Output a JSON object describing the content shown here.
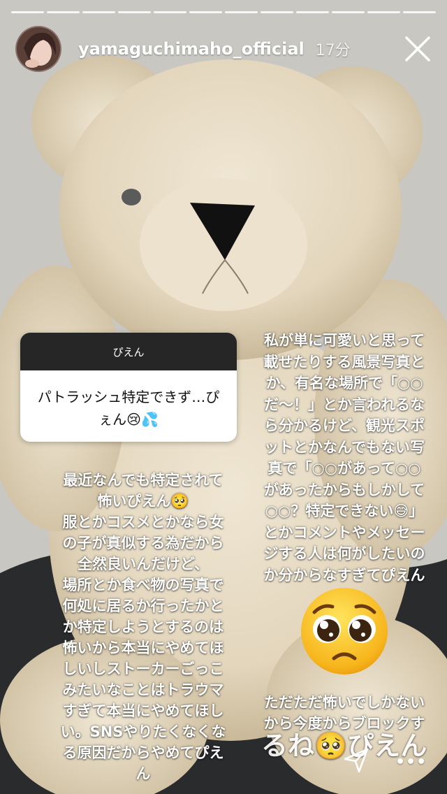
{
  "story": {
    "segments": 12,
    "username": "yamaguchimaho_official",
    "time": "17分"
  },
  "question_sticker": {
    "header": "ぴえん",
    "body": "パトラッシュ特定できず…ぴぇん😢💦"
  },
  "left_text": "最近なんでも特定されて\n怖いぴえん🥺\n服とかコスメとかなら女\nの子が真似する為だから\n全然良いんだけど、\n場所とか食べ物の写真で\n何処に居るか行ったかと\nか特定しようとするのは\n怖いから本当にやめてほ\nしいしストーカーごっこ\nみたいなことはトラウマ\nすぎて本当にやめてほし\nい。SNSやりたくなくな\nる原因だからやめてぴえ\nん",
  "right_text": "私が単に可愛いと思って\n載せたりする風景写真と\nか、有名な場所で「○○\nだ〜！」とか言われるな\nら分かるけど、観光スポ\nットとかなんでもない写\n真で「○○があって○○\nがあったからもしかして\n○○？特定できない😅」\nとかコメントやメッセー\nジする人は何がしたいの\nか分からなすぎてぴえん",
  "bottom_text_1": "ただただ怖いでしかない\nから今度からブロックす",
  "bottom_text_2": "るね🥺ぴえん",
  "icons": {
    "close": "close-icon",
    "send": "send-icon",
    "more": "more-icon",
    "pleading_face": "pleading-face-emoji"
  },
  "more_label": "•••"
}
